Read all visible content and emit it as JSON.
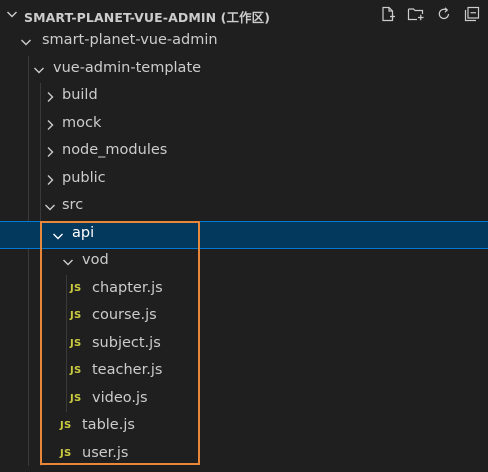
{
  "header": {
    "title": "SMART-PLANET-VUE-ADMIN (工作区)",
    "actions": [
      {
        "name": "new-file-icon"
      },
      {
        "name": "new-folder-icon"
      },
      {
        "name": "refresh-icon"
      },
      {
        "name": "collapse-all-icon"
      }
    ]
  },
  "tree": {
    "root": "smart-planet-vue-admin",
    "template": "vue-admin-template",
    "build": "build",
    "mock": "mock",
    "node_modules": "node_modules",
    "public": "public",
    "src": "src",
    "api": "api",
    "vod": "vod",
    "chapter": "chapter.js",
    "course": "course.js",
    "subject": "subject.js",
    "teacher": "teacher.js",
    "video": "video.js",
    "table": "table.js",
    "user": "user.js",
    "js_badge": "JS"
  },
  "colors": {
    "background": "#1f1f1f",
    "selection": "#04395e",
    "focus_border": "#0078d4",
    "js_icon": "#cbcb41",
    "annotation_box": "#e8863a"
  }
}
